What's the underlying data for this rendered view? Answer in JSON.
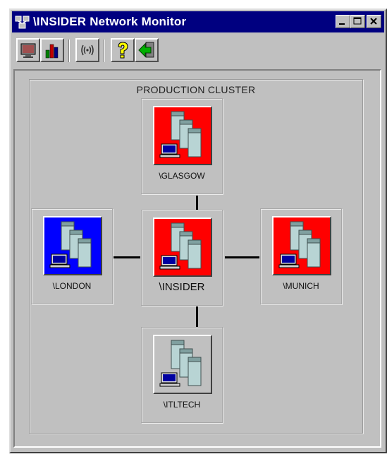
{
  "window": {
    "title": "\\INSIDER Network Monitor",
    "title_icon": "network-monitor-icon",
    "controls": [
      "minimize",
      "maximize",
      "close"
    ]
  },
  "toolbar": {
    "buttons": [
      {
        "name": "monitor-view",
        "icon": "monitor-icon"
      },
      {
        "name": "chart-view",
        "icon": "bar-chart-icon"
      },
      {
        "name": "signal",
        "icon": "signal-icon"
      },
      {
        "name": "help",
        "icon": "help-question-icon"
      },
      {
        "name": "exit",
        "icon": "green-arrow-icon"
      }
    ]
  },
  "cluster": {
    "label": "PRODUCTION CLUSTER",
    "nodes": [
      {
        "id": "glasgow",
        "label": "\\GLASGOW",
        "status_color": "#ff0000"
      },
      {
        "id": "london",
        "label": "\\LONDON",
        "status_color": "#0000ff"
      },
      {
        "id": "insider",
        "label": "\\INSIDER",
        "status_color": "#ff0000"
      },
      {
        "id": "munich",
        "label": "\\MUNICH",
        "status_color": "#ff0000"
      },
      {
        "id": "itltech",
        "label": "\\ITLTECH",
        "status_color": "#c0c0c0"
      }
    ]
  },
  "colors": {
    "titlebar": "#000080",
    "face": "#c0c0c0",
    "alert": "#ff0000",
    "ok": "#0000ff"
  }
}
